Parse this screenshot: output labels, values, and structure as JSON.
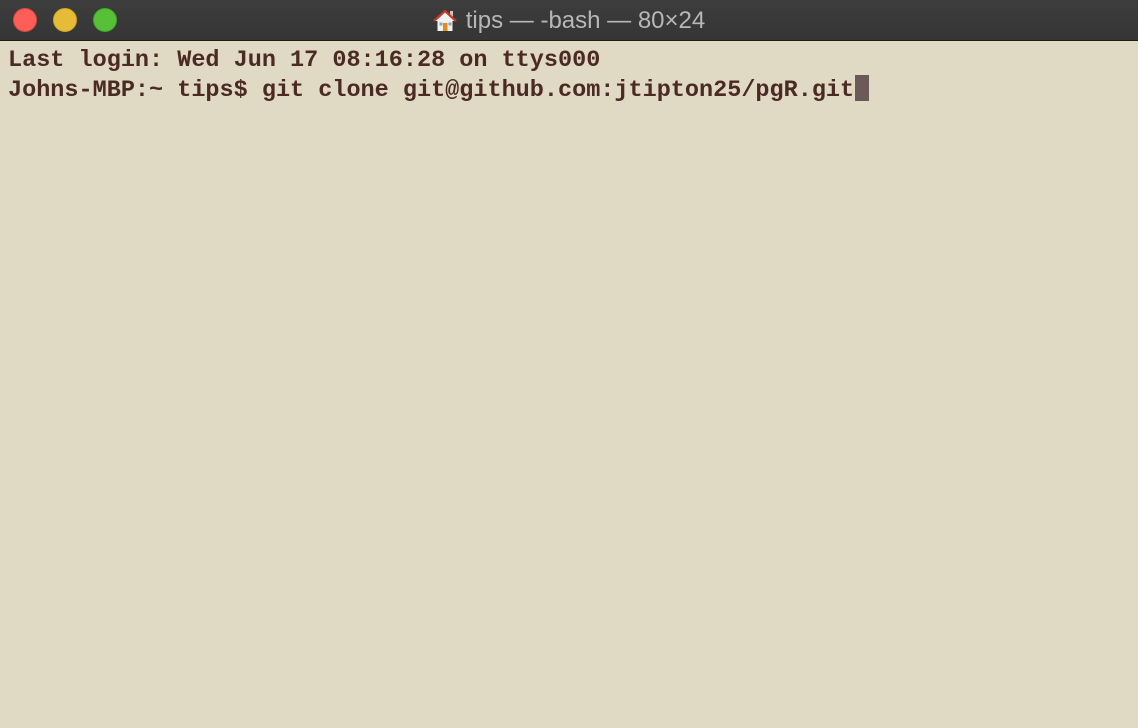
{
  "window": {
    "title": "tips — -bash — 80×24",
    "title_icon": "home-icon",
    "buttons": {
      "close": "close-button",
      "minimize": "minimize-button",
      "zoom": "zoom-button"
    }
  },
  "terminal": {
    "lines": [
      "Last login: Wed Jun 17 08:16:28 on ttys000",
      "Johns-MBP:~ tips$ git clone git@github.com:jtipton25/pgR.git"
    ]
  },
  "colors": {
    "background": "#e0d9c3",
    "text": "#4a2a22",
    "cursor": "#6b5a57",
    "titlebar": "#383838",
    "close": "#fd5e57",
    "minimize": "#e6bc37",
    "zoom": "#57c038"
  }
}
